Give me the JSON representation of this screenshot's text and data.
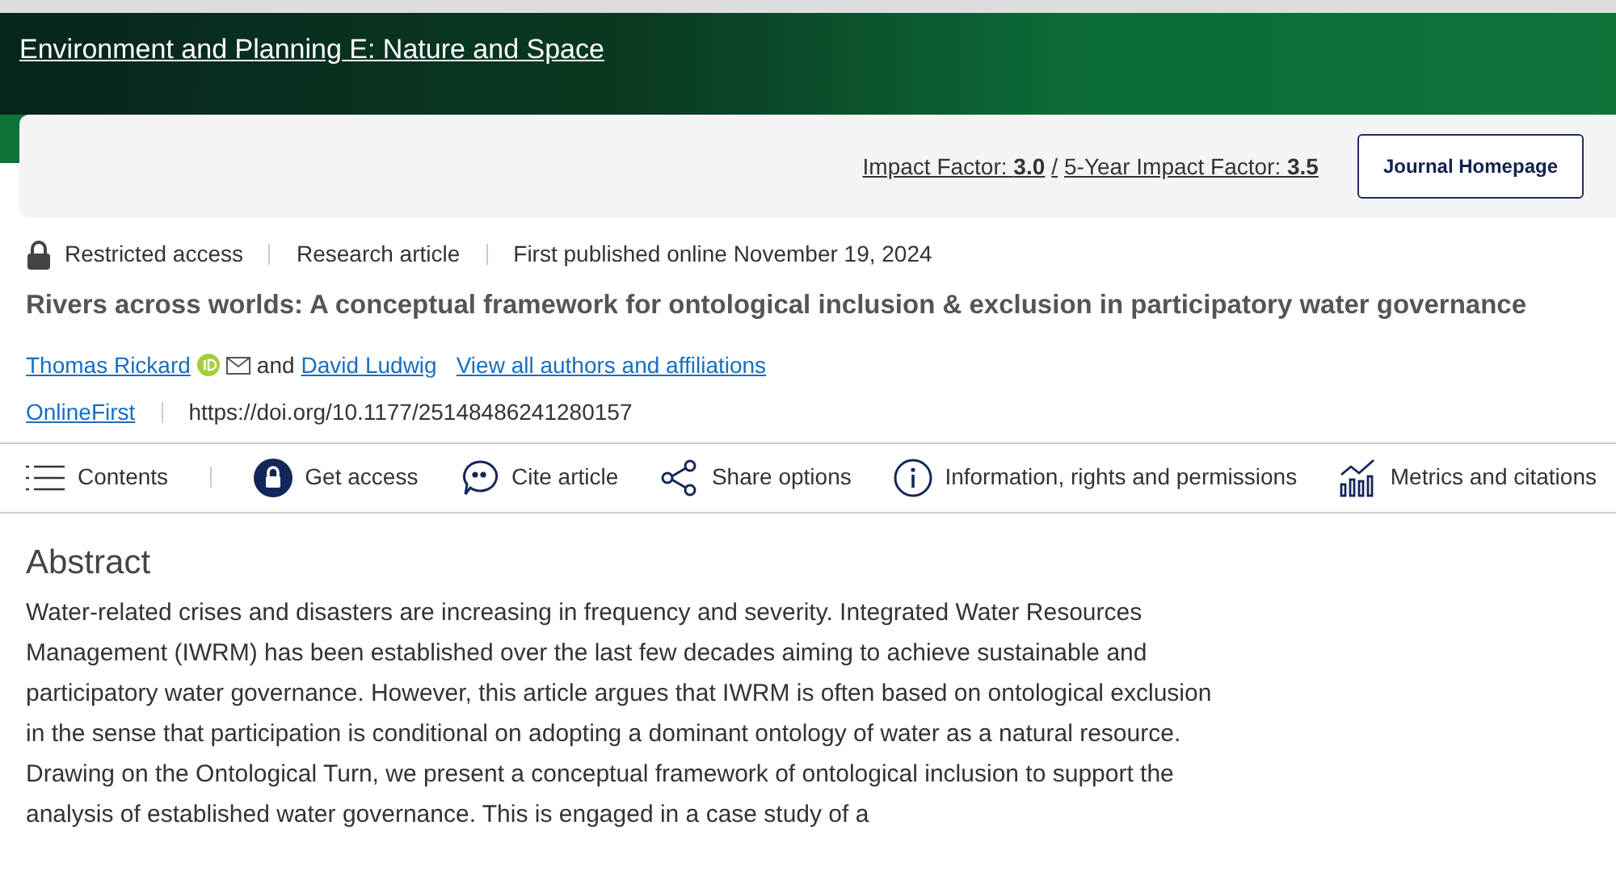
{
  "journal": {
    "title": "Environment and Planning E: Nature and Space"
  },
  "metrics": [
    {
      "label": "Impact Factor: ",
      "value": "3.0"
    },
    {
      "label": "5-Year Impact Factor: ",
      "value": "3.5"
    }
  ],
  "metrics_separator": "/",
  "homepage_button": "Journal Homepage",
  "meta": [
    {
      "kind": "access",
      "text": "Restricted access"
    },
    {
      "kind": "plain",
      "text": "Research article"
    },
    {
      "kind": "plain",
      "text": "First published online November 19, 2024"
    }
  ],
  "article_title": "Rivers across worlds: A conceptual framework for ontological inclusion & exclusion in participatory water governance",
  "authors": [
    {
      "name": "Thomas Rickard",
      "orcid": true,
      "email": true
    },
    {
      "name": "David Ludwig",
      "orcid": false,
      "email": false
    }
  ],
  "authors_joiner": "and",
  "all_authors_link": "View all authors and affiliations",
  "issue_link": "OnlineFirst",
  "doi": "https://doi.org/10.1177/25148486241280157",
  "toolbar": [
    {
      "kind": "contents",
      "label": "Contents"
    },
    {
      "kind": "lock",
      "label": "Get access"
    },
    {
      "kind": "quote",
      "label": "Cite article"
    },
    {
      "kind": "share",
      "label": "Share options"
    },
    {
      "kind": "info",
      "label": "Information, rights and permissions"
    },
    {
      "kind": "metrics",
      "label": "Metrics and citations"
    }
  ],
  "abstract": {
    "heading": "Abstract",
    "text": "Water-related crises and disasters are increasing in frequency and severity. Integrated Water Resources Management (IWRM) has been established over the last few decades aiming to achieve sustainable and participatory water governance. However, this article argues that IWRM is often based on ontological exclusion in the sense that participation is conditional on adopting a dominant ontology of water as a natural resource. Drawing on the Ontological Turn, we present a conceptual framework of ontological inclusion to support the analysis of established water governance. This is engaged in a case study of a"
  }
}
